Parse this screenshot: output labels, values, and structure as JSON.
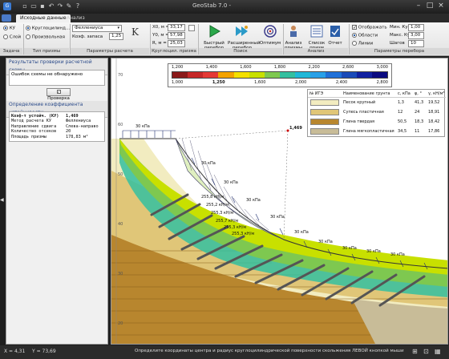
{
  "window": {
    "title": "GeoStab 7.0 -"
  },
  "tabs": [
    "Исходные данные",
    "Анализ"
  ],
  "ribbon": {
    "ku_label": "КУ",
    "soil_label": "Слоѝ",
    "circular_label": "Круглоцилинд...",
    "arbitrary_label": "Произвольная",
    "method_value": "Феллениуса",
    "reserve_label": "Коэф. запаса",
    "reserve_value": "1,25",
    "k_symbol": "K",
    "x0_label": "X0, м =",
    "x0_value": "33,17",
    "y0_label": "Y0, м =",
    "y0_value": "57,98",
    "r_label": "R, м =",
    "r_value": "25,03",
    "quick_label": "Быстрый перебор",
    "extended_label": "Расширенный перебор",
    "optimum_label": "Оптимум",
    "analysis_label": "Анализ призмы",
    "list_label": "Список призм",
    "report_label": "Отчет",
    "show_label": "Отображать",
    "areas_label": "Области",
    "lines_label": "Линии",
    "min_ku_label": "Мин. Ку",
    "min_ku_value": "1,00",
    "max_ku_label": "Макс. Ку",
    "max_ku_value": "3,00",
    "step_label": "Шагов",
    "step_value": "10",
    "groups": [
      "Задача",
      "Тип призмы",
      "Параметры расчета",
      "Круглоцил. призма",
      "Поиск",
      "Анализ",
      "Параметры перебора"
    ]
  },
  "left_panel": {
    "check_header": "Результаты проверки расчетной схемы",
    "check_message": "Ошибок схемы не обнаружено",
    "check_button": "Проверка",
    "ku_header": "Определение коэффициента устойчивости",
    "results": [
      [
        "Коэф-т устойч. (КУ)",
        "1,469"
      ],
      [
        "Метод расчета КУ",
        "Феллениуса"
      ],
      [
        "Направление сдвига",
        "Слева-направо"
      ],
      [
        "Количество отсеков",
        "20"
      ],
      [
        "Площадь призмы",
        "178,83 м²"
      ]
    ]
  },
  "color_scale": {
    "top_ticks": [
      "1,200",
      "1,400",
      "1,600",
      "1,800",
      "2,200",
      "2,600",
      "3,000"
    ],
    "bottom_ticks": [
      "1,000",
      "1,250",
      "1,600",
      "2,000",
      "2,400",
      "2,800"
    ],
    "colors": [
      "#8b1a1a",
      "#c62828",
      "#e53935",
      "#f4a300",
      "#f4e000",
      "#c8e000",
      "#7ec850",
      "#34c0a0",
      "#20b8d8",
      "#28a0e8",
      "#2070d8",
      "#1a4ab8",
      "#1020a0",
      "#0a0a80"
    ]
  },
  "soil_table": {
    "headers": [
      "№ ИГЭ",
      "Наименование грунта",
      "c, кПа",
      "φ, °",
      "γ, кН/м³"
    ],
    "rows": [
      {
        "color": "#f2ecc0",
        "name": "Песок крупный",
        "c": "1,3",
        "phi": "41,3",
        "gamma": "19,52"
      },
      {
        "color": "#e0c678",
        "name": "Супесь пластичная",
        "c": "12",
        "phi": "24",
        "gamma": "18,91"
      },
      {
        "color": "#b8862e",
        "name": "Глина твердая",
        "c": "50,5",
        "phi": "18,3",
        "gamma": "18,42"
      },
      {
        "color": "#c8bc98",
        "name": "Глина мягкопластичная",
        "c": "34,5",
        "phi": "11",
        "gamma": "17,86"
      }
    ]
  },
  "drawing": {
    "y_ticks": [
      "70",
      "60",
      "50",
      "40",
      "30",
      "20"
    ],
    "ku_mark": "1,469",
    "load_labels": [
      "30 кПа",
      "30 кПа",
      "30 кПа",
      "30 кПа",
      "30 кПа",
      "30 кПа",
      "30 кПа",
      "30 кПа",
      "30 кПа",
      "30 кПа"
    ],
    "prism_labels": [
      "255,8 кН/м",
      "255,2 кН/м",
      "255,3 кН/м",
      "255,7 кН/м",
      "255,3 кН/м",
      "255,3 кН/м"
    ]
  },
  "status": {
    "x_label": "X = 4,31",
    "y_label": "Y = 73,69",
    "message": "Определите координаты центра и радиус круглоцилиндрической поверхности скольжения ЛЕВОЙ кнопкой мыши"
  }
}
